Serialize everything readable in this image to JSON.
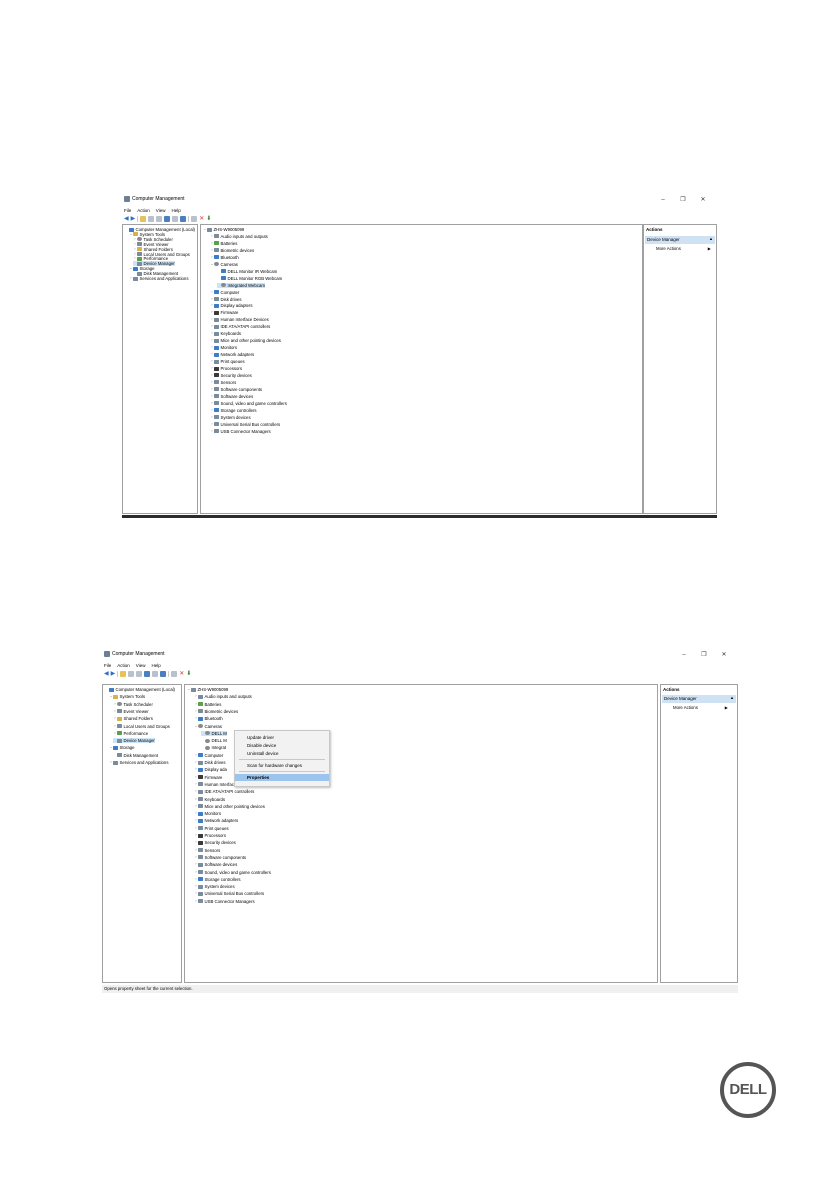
{
  "window_title": "Computer Management",
  "menu": [
    "File",
    "Action",
    "View",
    "Help"
  ],
  "tree_left": [
    {
      "label": "Computer Management (Local)",
      "indent": 0,
      "icon": "computer-icon",
      "chev": ""
    },
    {
      "label": "System Tools",
      "indent": 1,
      "icon": "tools-icon",
      "chev": "v"
    },
    {
      "label": "Task Scheduler",
      "indent": 2,
      "icon": "clock-icon",
      "chev": ">"
    },
    {
      "label": "Event Viewer",
      "indent": 2,
      "icon": "event-viewer-icon",
      "chev": ">"
    },
    {
      "label": "Shared Folders",
      "indent": 2,
      "icon": "folder-icon",
      "chev": ">"
    },
    {
      "label": "Local Users and Groups",
      "indent": 2,
      "icon": "users-icon",
      "chev": ">"
    },
    {
      "label": "Performance",
      "indent": 2,
      "icon": "performance-icon",
      "chev": ">"
    },
    {
      "label": "Device Manager",
      "indent": 2,
      "icon": "device-manager-icon",
      "chev": "",
      "selected": true
    },
    {
      "label": "Storage",
      "indent": 1,
      "icon": "storage-icon",
      "chev": "v"
    },
    {
      "label": "Disk Management",
      "indent": 2,
      "icon": "disk-icon",
      "chev": ""
    },
    {
      "label": "Services and Applications",
      "indent": 1,
      "icon": "services-icon",
      "chev": ">"
    }
  ],
  "devices_1": [
    {
      "label": "ZHS-W9005099",
      "indent": 0,
      "chev": "v"
    },
    {
      "label": "Audio inputs and outputs",
      "indent": 1,
      "chev": ">"
    },
    {
      "label": "Batteries",
      "indent": 1,
      "chev": ">"
    },
    {
      "label": "Biometric devices",
      "indent": 1,
      "chev": ">"
    },
    {
      "label": "Bluetooth",
      "indent": 1,
      "chev": ">"
    },
    {
      "label": "Cameras",
      "indent": 1,
      "chev": "v"
    },
    {
      "label": "DELL Monitor IR Webcam",
      "indent": 2,
      "chev": ""
    },
    {
      "label": "DELL Monitor RGB Webcam",
      "indent": 2,
      "chev": ""
    },
    {
      "label": "Integrated Webcam",
      "indent": 2,
      "chev": "",
      "selected": true
    },
    {
      "label": "Computer",
      "indent": 1,
      "chev": ">"
    },
    {
      "label": "Disk drives",
      "indent": 1,
      "chev": ">"
    },
    {
      "label": "Display adapters",
      "indent": 1,
      "chev": ">"
    },
    {
      "label": "Firmware",
      "indent": 1,
      "chev": ">"
    },
    {
      "label": "Human Interface Devices",
      "indent": 1,
      "chev": ">"
    },
    {
      "label": "IDE ATA/ATAPI controllers",
      "indent": 1,
      "chev": ">"
    },
    {
      "label": "Keyboards",
      "indent": 1,
      "chev": ">"
    },
    {
      "label": "Mice and other pointing devices",
      "indent": 1,
      "chev": ">"
    },
    {
      "label": "Monitors",
      "indent": 1,
      "chev": ">"
    },
    {
      "label": "Network adapters",
      "indent": 1,
      "chev": ">"
    },
    {
      "label": "Print queues",
      "indent": 1,
      "chev": ">"
    },
    {
      "label": "Processors",
      "indent": 1,
      "chev": ">"
    },
    {
      "label": "Security devices",
      "indent": 1,
      "chev": ">"
    },
    {
      "label": "Sensors",
      "indent": 1,
      "chev": ">"
    },
    {
      "label": "Software components",
      "indent": 1,
      "chev": ">"
    },
    {
      "label": "Software devices",
      "indent": 1,
      "chev": ">"
    },
    {
      "label": "Sound, video and game controllers",
      "indent": 1,
      "chev": ">"
    },
    {
      "label": "Storage controllers",
      "indent": 1,
      "chev": ">"
    },
    {
      "label": "System devices",
      "indent": 1,
      "chev": ">"
    },
    {
      "label": "Universal Serial Bus controllers",
      "indent": 1,
      "chev": ">"
    },
    {
      "label": "USB Connector Managers",
      "indent": 1,
      "chev": ">"
    }
  ],
  "devices_2": [
    {
      "label": "ZHS-W9005099",
      "indent": 0,
      "chev": "v"
    },
    {
      "label": "Audio inputs and outputs",
      "indent": 1,
      "chev": ">"
    },
    {
      "label": "Batteries",
      "indent": 1,
      "chev": ">"
    },
    {
      "label": "Biometric devices",
      "indent": 1,
      "chev": ">"
    },
    {
      "label": "Bluetooth",
      "indent": 1,
      "chev": ">"
    },
    {
      "label": "Cameras",
      "indent": 1,
      "chev": "v"
    },
    {
      "label": "DELL M",
      "indent": 2,
      "chev": "",
      "selected": true
    },
    {
      "label": "DELL M",
      "indent": 2,
      "chev": ""
    },
    {
      "label": "Integrat",
      "indent": 2,
      "chev": ""
    },
    {
      "label": "Computer",
      "indent": 1,
      "chev": ">"
    },
    {
      "label": "Disk drives",
      "indent": 1,
      "chev": ">"
    },
    {
      "label": "Display ada",
      "indent": 1,
      "chev": ">"
    },
    {
      "label": "Firmware",
      "indent": 1,
      "chev": ">"
    },
    {
      "label": "Human Interface Devices",
      "indent": 1,
      "chev": ">"
    },
    {
      "label": "IDE ATA/ATAPI controllers",
      "indent": 1,
      "chev": ">"
    },
    {
      "label": "Keyboards",
      "indent": 1,
      "chev": ">"
    },
    {
      "label": "Mice and other pointing devices",
      "indent": 1,
      "chev": ">"
    },
    {
      "label": "Monitors",
      "indent": 1,
      "chev": ">"
    },
    {
      "label": "Network adapters",
      "indent": 1,
      "chev": ">"
    },
    {
      "label": "Print queues",
      "indent": 1,
      "chev": ">"
    },
    {
      "label": "Processors",
      "indent": 1,
      "chev": ">"
    },
    {
      "label": "Security devices",
      "indent": 1,
      "chev": ">"
    },
    {
      "label": "Sensors",
      "indent": 1,
      "chev": ">"
    },
    {
      "label": "Software components",
      "indent": 1,
      "chev": ">"
    },
    {
      "label": "Software devices",
      "indent": 1,
      "chev": ">"
    },
    {
      "label": "Sound, video and game controllers",
      "indent": 1,
      "chev": ">"
    },
    {
      "label": "Storage controllers",
      "indent": 1,
      "chev": ">"
    },
    {
      "label": "System devices",
      "indent": 1,
      "chev": ">"
    },
    {
      "label": "Universal Serial Bus controllers",
      "indent": 1,
      "chev": ">"
    },
    {
      "label": "USB Connector Managers",
      "indent": 1,
      "chev": ">"
    }
  ],
  "actions": {
    "header": "Actions",
    "section": "Device Manager",
    "more": "More Actions"
  },
  "context_menu": {
    "update": "Update driver",
    "disable": "Disable device",
    "uninstall": "Uninstall device",
    "scan": "Scan for hardware changes",
    "properties": "Properties"
  },
  "status_text": "Opens property sheet for the current selection.",
  "logo_text": "DELL"
}
